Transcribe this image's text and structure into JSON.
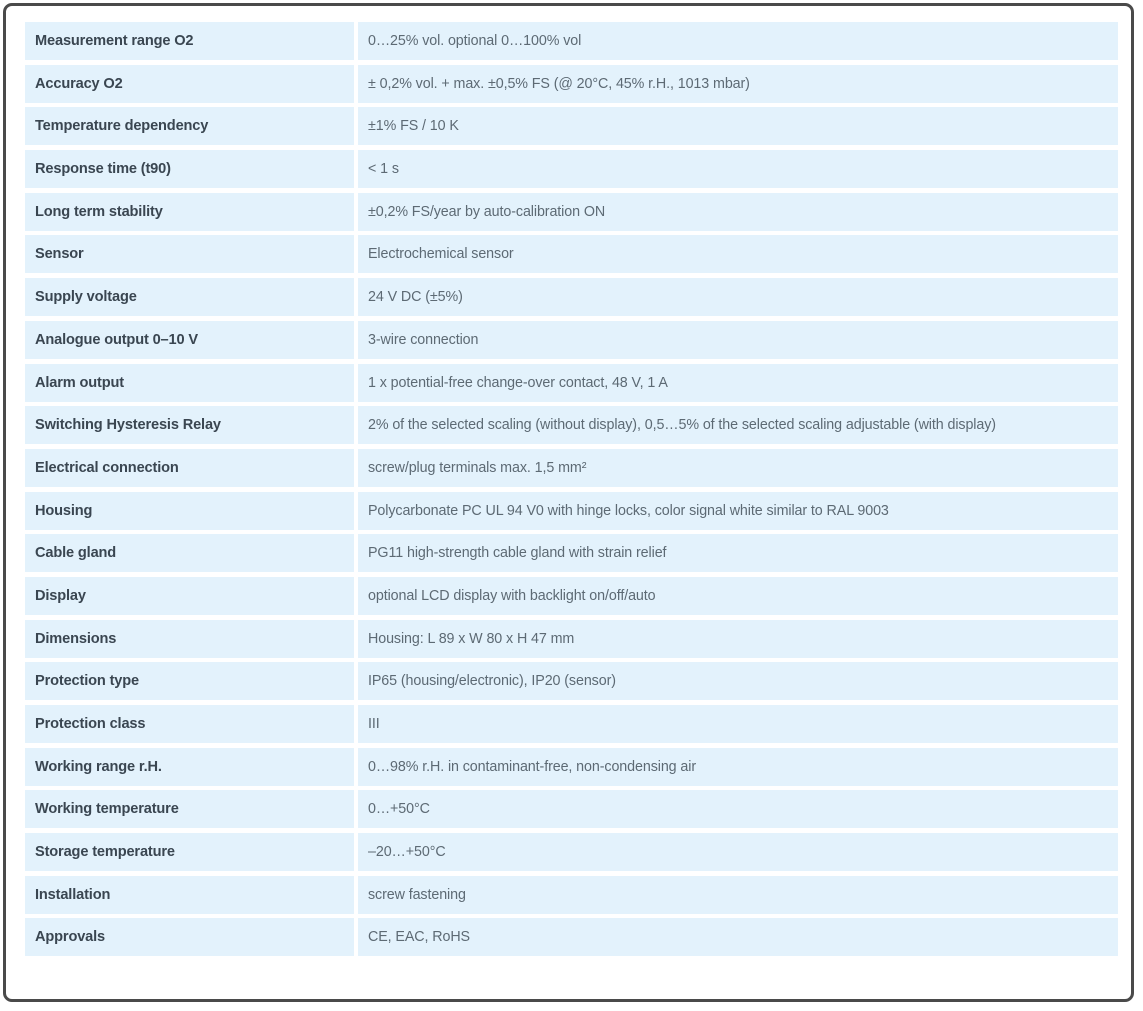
{
  "table": {
    "rows": [
      {
        "label": "Measurement range O2",
        "value": "0…25% vol. optional 0…100% vol"
      },
      {
        "label": "Accuracy O2",
        "value": "± 0,2% vol. + max. ±0,5% FS (@ 20°C, 45% r.H., 1013 mbar)"
      },
      {
        "label": "Temperature dependency",
        "value": "±1% FS / 10 K"
      },
      {
        "label": "Response time (t90)",
        "value": "< 1 s"
      },
      {
        "label": "Long term stability",
        "value": "±0,2% FS/year by auto-calibration ON"
      },
      {
        "label": "Sensor",
        "value": "Electrochemical sensor"
      },
      {
        "label": "Supply voltage",
        "value": "24 V DC (±5%)"
      },
      {
        "label": "Analogue output 0–10 V",
        "value": "3-wire connection"
      },
      {
        "label": "Alarm output",
        "value": "1 x potential-free change-over contact, 48 V, 1 A"
      },
      {
        "label": "Switching Hysteresis Relay",
        "value": "2% of the selected scaling (without display), 0,5…5% of the selected scaling adjustable (with display)"
      },
      {
        "label": "Electrical connection",
        "value": "screw/plug terminals max. 1,5 mm²"
      },
      {
        "label": "Housing",
        "value": "Polycarbonate PC UL 94 V0 with hinge locks, color signal white similar to RAL 9003"
      },
      {
        "label": "Cable gland",
        "value": "PG11 high-strength cable gland with strain relief"
      },
      {
        "label": "Display",
        "value": "optional LCD display with backlight on/off/auto"
      },
      {
        "label": "Dimensions",
        "value": "Housing: L 89 x W 80 x H 47 mm"
      },
      {
        "label": "Protection type",
        "value": "IP65 (housing/electronic), IP20 (sensor)"
      },
      {
        "label": "Protection class",
        "value": "III"
      },
      {
        "label": "Working range r.H.",
        "value": "0…98% r.H. in contaminant-free, non-condensing air"
      },
      {
        "label": "Working temperature",
        "value": "0…+50°C"
      },
      {
        "label": "Storage temperature",
        "value": "–20…+50°C"
      },
      {
        "label": "Installation",
        "value": "screw fastening"
      },
      {
        "label": "Approvals",
        "value": "CE, EAC, RoHS"
      }
    ]
  }
}
